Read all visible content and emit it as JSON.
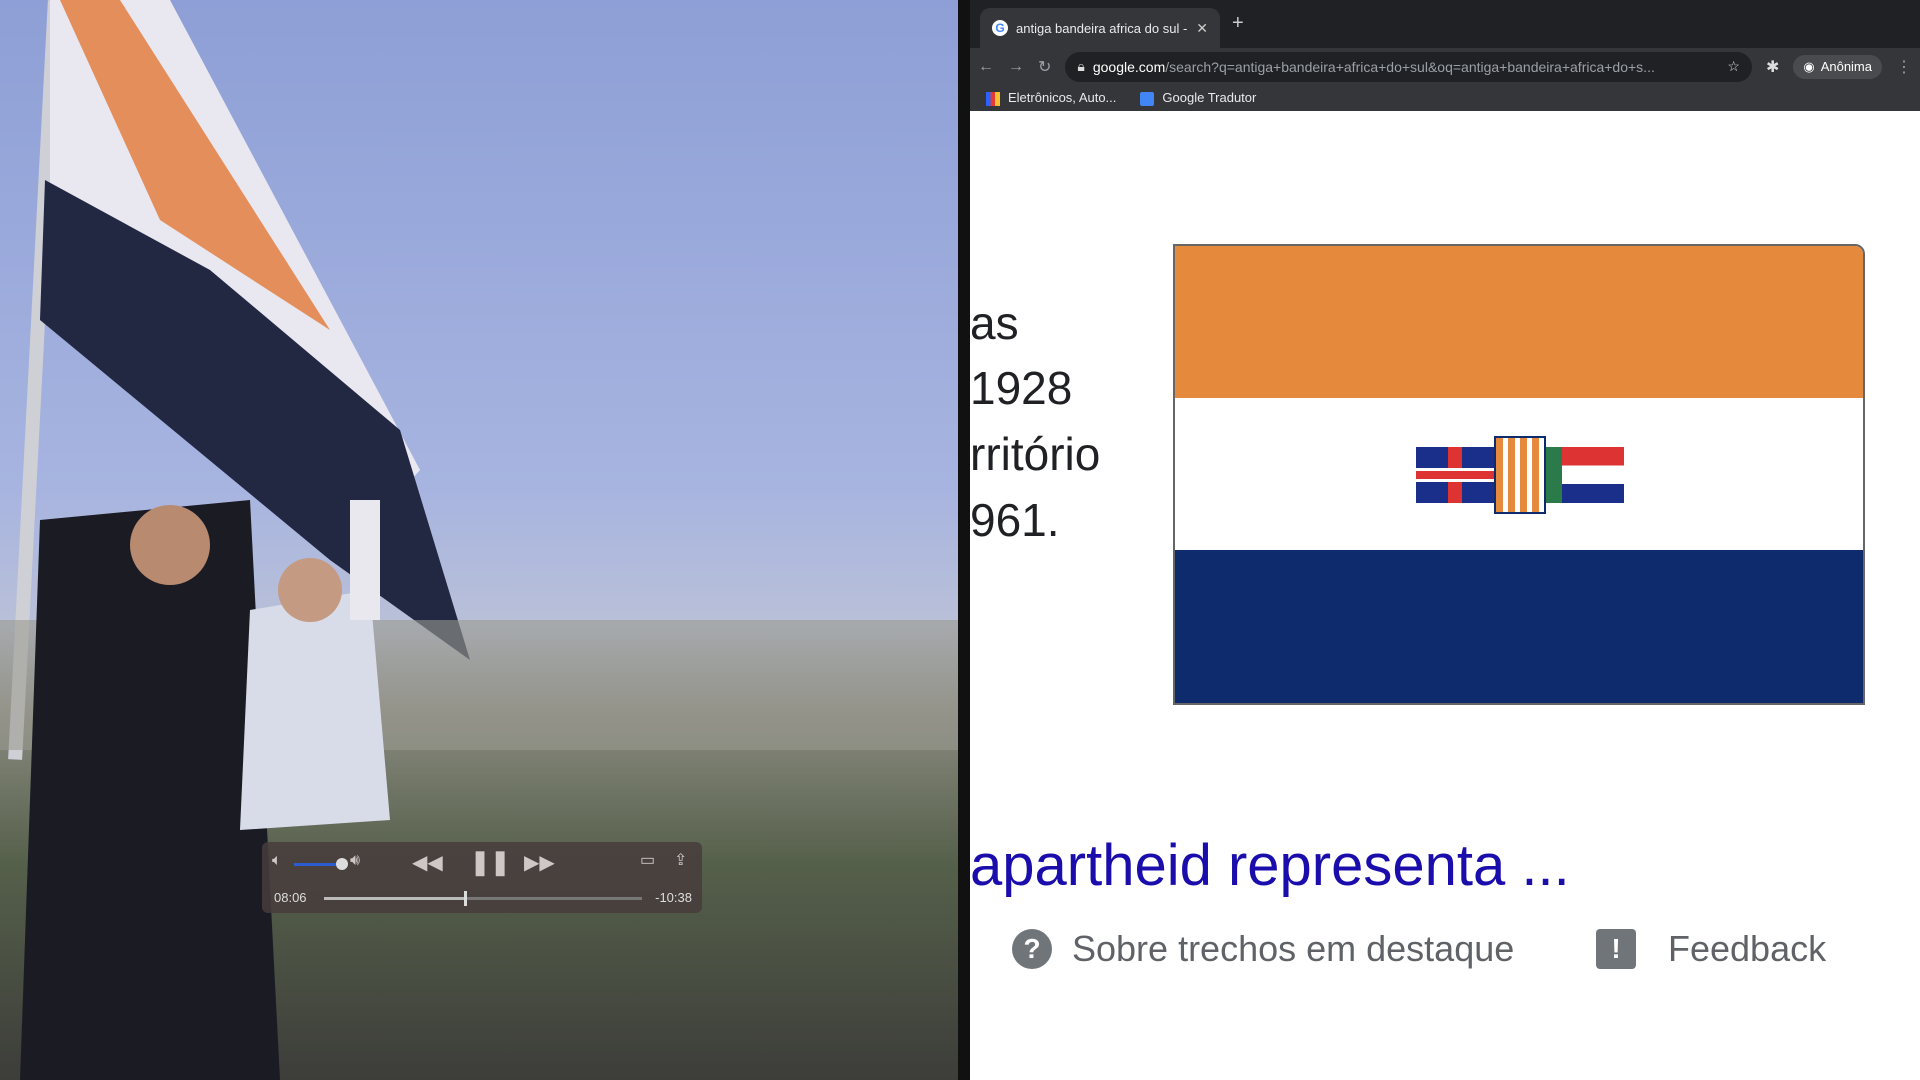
{
  "browser": {
    "tab_title": "antiga bandeira africa do sul -",
    "url_domain": "google.com",
    "url_path": "/search?q=antiga+bandeira+africa+do+sul&oq=antiga+bandeira+africa+do+s...",
    "profile": "Anônima",
    "bookmarks": [
      {
        "label": "Eletrônicos, Auto..."
      },
      {
        "label": "Google Tradutor"
      }
    ]
  },
  "page": {
    "text_lines": [
      "as",
      " 1928",
      "rritório",
      "961."
    ],
    "result_heading": "apartheid representa ...",
    "about_snippets": "Sobre trechos em destaque",
    "feedback": "Feedback"
  },
  "player": {
    "elapsed": "08:06",
    "remaining": "-10:38",
    "progress": 0.44,
    "volume": 1.0,
    "state": "playing"
  },
  "colors": {
    "flag_orange": "#e58a3c",
    "flag_white": "#ffffff",
    "flag_blue": "#0e2b6e",
    "link": "#1a0dab"
  }
}
